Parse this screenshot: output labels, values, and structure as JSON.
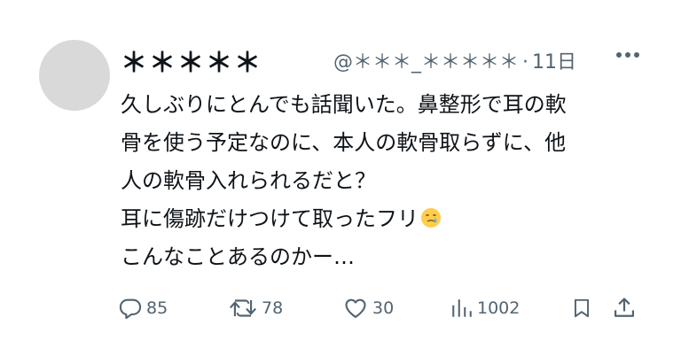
{
  "tweet": {
    "display_name": "＊＊＊＊＊",
    "handle": "@＊＊＊_＊＊＊＊＊",
    "separator": "·",
    "time": "11日",
    "text_lines": [
      "久しぶりにとんでも話聞いた。鼻整形で耳の軟",
      "骨を使う予定なのに、本人の軟骨取らずに、他",
      "人の軟骨入れられるだと？",
      " 耳に傷跡だけつけて取ったフリ",
      " こんなことあるのかー…"
    ],
    "emoji": "crying-smile-emoji"
  },
  "actions": {
    "reply": {
      "icon": "reply-icon",
      "count": "85"
    },
    "retweet": {
      "icon": "retweet-icon",
      "count": "78"
    },
    "like": {
      "icon": "heart-icon",
      "count": "30"
    },
    "views": {
      "icon": "analytics-icon",
      "count": "1002"
    },
    "bookmark": {
      "icon": "bookmark-icon"
    },
    "share": {
      "icon": "share-icon"
    }
  },
  "colors": {
    "text": "#0f1419",
    "secondary": "#536471",
    "avatar": "#d9d9d9"
  }
}
